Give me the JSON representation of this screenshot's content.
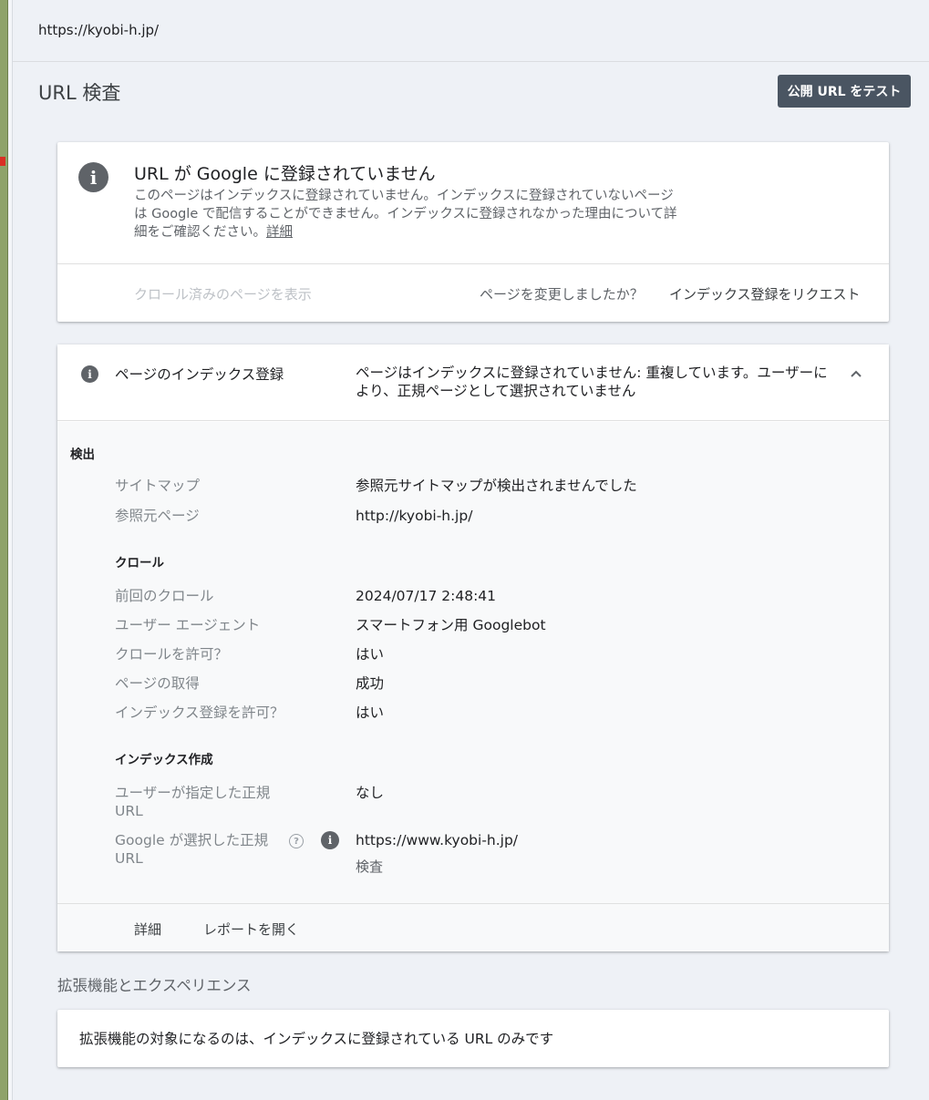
{
  "topbar": {
    "url": "https://kyobi-h.jp/"
  },
  "page": {
    "title": "URL 検査",
    "test_button": "公開 URL をテスト"
  },
  "status_card": {
    "headline": "URL が Google に登録されていません",
    "description": "このページはインデックスに登録されていません。インデックスに登録されていないページは Google で配信することができません。インデックスに登録されなかった理由について詳細をご確認ください。",
    "details_link": "詳細",
    "view_crawled": "クロール済みのページを表示",
    "changed_question": "ページを変更しましたか？",
    "request_indexing": "インデックス登録をリクエスト"
  },
  "index_card": {
    "label": "ページのインデックス登録",
    "status": "ページはインデックスに登録されていません: 重複しています。ユーザーにより、正規ページとして選択されていません",
    "sections": {
      "discovery": "検出",
      "crawl": "クロール",
      "indexing": "インデックス作成"
    },
    "rows": {
      "sitemap": {
        "key": "サイトマップ",
        "value": "参照元サイトマップが検出されませんでした"
      },
      "referring_page": {
        "key": "参照元ページ",
        "value": "http://kyobi-h.jp/"
      },
      "last_crawl": {
        "key": "前回のクロール",
        "value": "2024/07/17 2:48:41"
      },
      "user_agent": {
        "key": "ユーザー エージェント",
        "value": "スマートフォン用 Googlebot"
      },
      "crawl_allowed": {
        "key": "クロールを許可？",
        "value": "はい"
      },
      "page_fetch": {
        "key": "ページの取得",
        "value": "成功"
      },
      "indexing_allowed": {
        "key": "インデックス登録を許可？",
        "value": "はい"
      },
      "user_canonical": {
        "key_line1": "ユーザーが指定した正規",
        "key_line2": "URL",
        "value": "なし"
      },
      "google_canonical": {
        "key_line1": "Google が選択した正規",
        "key_line2": "URL",
        "value": "https://www.kyobi-h.jp/",
        "inspect": "検査"
      }
    },
    "footer": {
      "details": "詳細",
      "open_report": "レポートを開く"
    }
  },
  "enhancements": {
    "title": "拡張機能とエクスペリエンス",
    "message": "拡張機能の対象になるのは、インデックスに登録されている URL のみです"
  },
  "colors": {
    "button_bg": "#4a5562",
    "icon_gray": "#5f6368",
    "left_strip": "#8fa36a"
  }
}
